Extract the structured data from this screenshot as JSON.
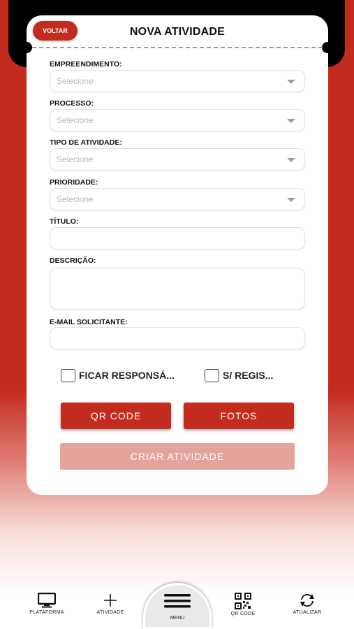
{
  "header": {
    "back_label": "VOLTAR",
    "title": "NOVA ATIVIDADE"
  },
  "form": {
    "empreendimento": {
      "label": "EMPREENDIMENTO:",
      "placeholder": "Selecione"
    },
    "processo": {
      "label": "PROCESSO:",
      "placeholder": "Selecione"
    },
    "tipo_atividade": {
      "label": "TIPO DE ATIVIDADE:",
      "placeholder": "Selecione"
    },
    "prioridade": {
      "label": "PRIORIDADE:",
      "placeholder": "Selecione"
    },
    "titulo": {
      "label": "TÍTULO:",
      "value": ""
    },
    "descricao": {
      "label": "DESCRIÇÃO:",
      "value": ""
    },
    "email": {
      "label": "E-MAIL SOLICITANTE:",
      "value": ""
    },
    "checkbox_responsavel": {
      "label": "FICAR RESPONSÁ...",
      "checked": false
    },
    "checkbox_registro": {
      "label": "S/ REGIS...",
      "checked": false
    }
  },
  "buttons": {
    "qr_code": "QR CODE",
    "fotos": "FOTOS",
    "criar": "CRIAR ATIVIDADE"
  },
  "nav": {
    "items": [
      {
        "label": "PLATAFORMA",
        "icon": "monitor-icon"
      },
      {
        "label": "ATIVIDADE",
        "icon": "plus-icon"
      },
      {
        "label": "MENU",
        "icon": "hamburger-icon"
      },
      {
        "label": "QR CODE",
        "icon": "qr-code-icon"
      },
      {
        "label": "ATUALIZAR",
        "icon": "refresh-icon"
      }
    ]
  },
  "colors": {
    "accent": "#c42b1f",
    "disabled_button": "#e4a39d",
    "header_black": "#000000"
  }
}
